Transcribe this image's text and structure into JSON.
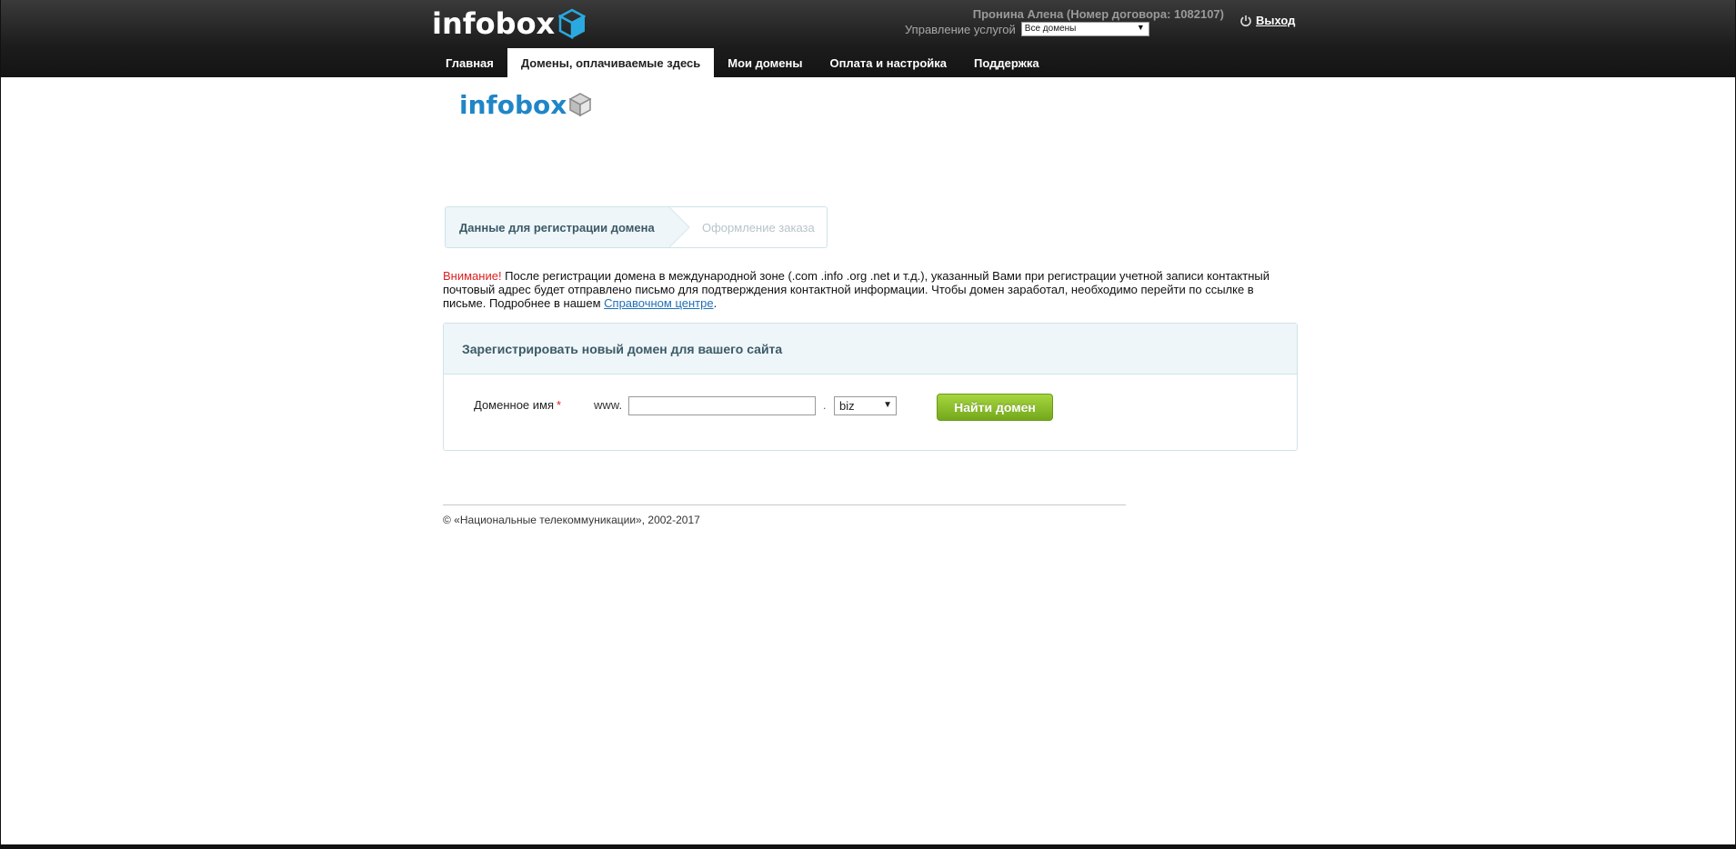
{
  "header": {
    "logo_text": "infobox",
    "user_info": "Пронина Алена (Номер договора: 1082107)",
    "services_label": "Управление услугой",
    "services_select_value": "Все домены",
    "logout_label": "Выход"
  },
  "nav": {
    "items": [
      {
        "label": "Главная"
      },
      {
        "label": "Домены, оплачиваемые здесь",
        "active": true
      },
      {
        "label": "Мои домены"
      },
      {
        "label": "Оплата и настройка"
      },
      {
        "label": "Поддержка"
      }
    ]
  },
  "content": {
    "logo_text": "infobox",
    "steps": {
      "step1": "Данные для регистрации домена",
      "step2": "Оформление заказа"
    },
    "notice": {
      "warning_word": "Внимание!",
      "text": " После регистрации домена в международной зоне (.com .info .org .net и т.д.), указанный Вами при регистрации учетной записи контактный почтовый адрес будет отправлено письмо для подтверждения контактной информации. Чтобы домен заработал, необходимо перейти по ссылке в письме. Подробнее в нашем ",
      "link_text": "Справочном центре",
      "tail": "."
    },
    "panel": {
      "title": "Зарегистрировать новый домен для вашего сайта",
      "field_label": "Доменное имя",
      "required_mark": "*",
      "prefix": "www.",
      "domain_value": "",
      "dot": ".",
      "tld_value": "biz",
      "button_label": "Найти домен"
    }
  },
  "footer": {
    "copyright": "© «Национальные телекоммуникации», 2002-2017"
  },
  "colors": {
    "brand_blue": "#1f86c7",
    "accent_green": "#8cc02c",
    "warning_red": "#e02020"
  }
}
